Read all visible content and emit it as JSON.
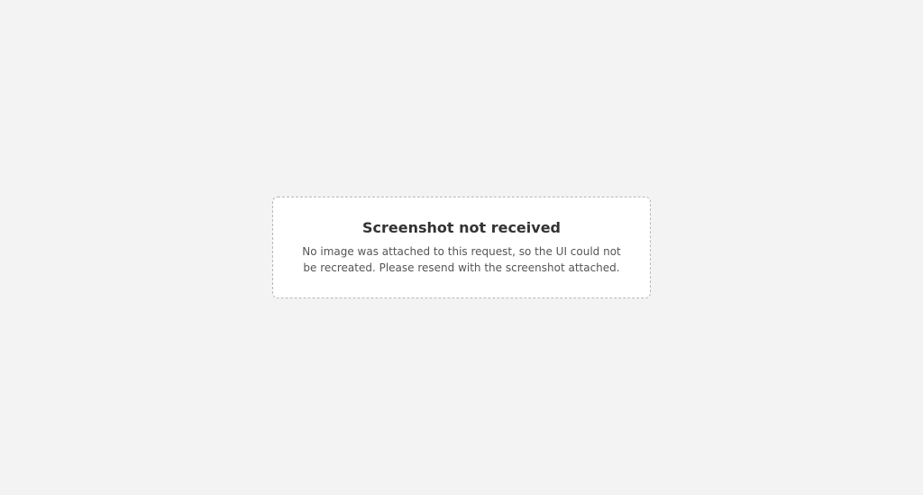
{
  "placeholder": {
    "title": "Screenshot not received",
    "message": "No image was attached to this request, so the UI could not be recreated. Please resend with the screenshot attached."
  }
}
